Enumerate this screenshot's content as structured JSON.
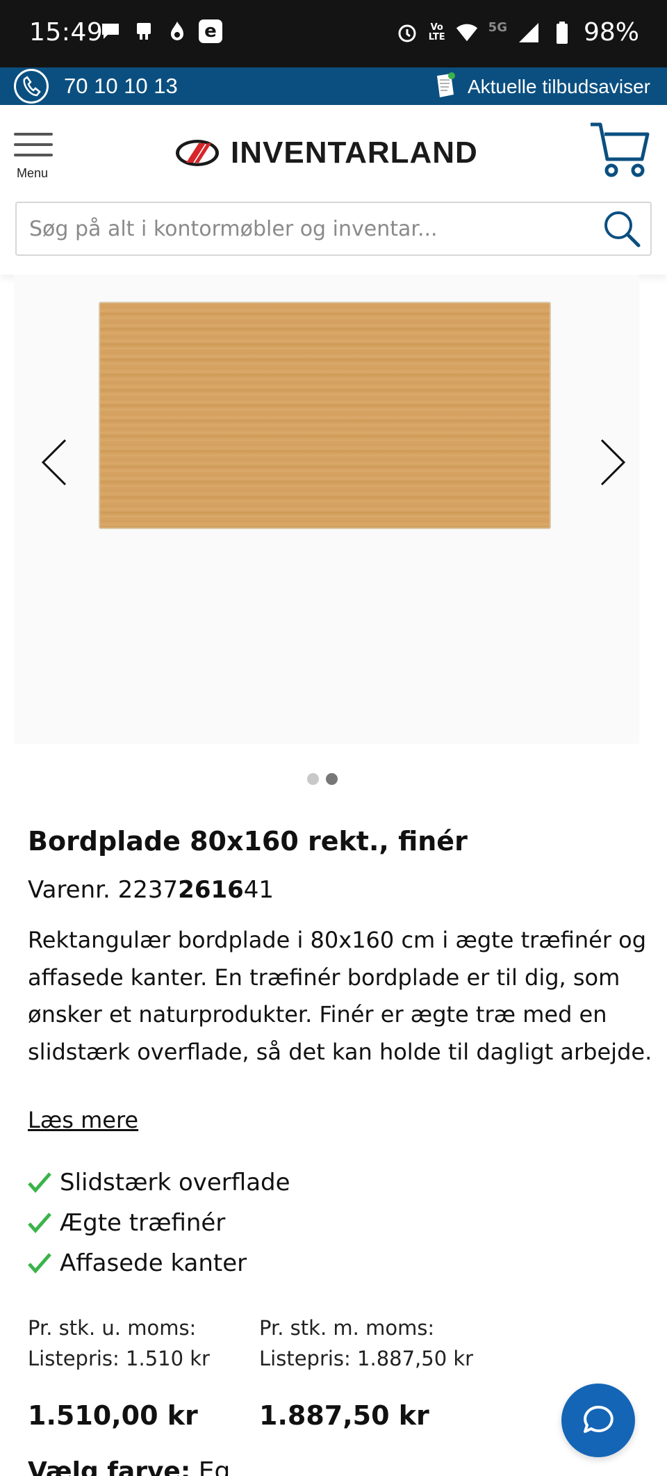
{
  "status_bar": {
    "time": "15:49",
    "battery": "98%",
    "network": "5G",
    "volte_top": "Vo",
    "volte_bottom": "LTE"
  },
  "topbar": {
    "phone": "70 10 10 13",
    "offers": "Aktuelle tilbudsaviser"
  },
  "header": {
    "menu_label": "Menu",
    "logo_text": "INVENTARLAND",
    "search_placeholder": "Søg på alt i kontormøbler og inventar..."
  },
  "gallery": {
    "slide_count": 2,
    "active_slide": 2
  },
  "product": {
    "title": "Bordplade 80x160 rekt., finér",
    "sku_prefix": "Varenr. 2237",
    "sku_bold": "2616",
    "sku_suffix": "41",
    "description": "Rektangulær bordplade i 80x160 cm i ægte træfinér og affasede kanter. En træfinér bordplade er til dig, som ønsker et naturprodukter. Finér er ægte træ med en slidstærk overflade, så det kan holde til dagligt arbejde.",
    "read_more": "Læs mere",
    "features": [
      "Slidstærk overflade",
      "Ægte træfinér",
      "Affasede kanter"
    ]
  },
  "prices": {
    "excl": {
      "label": "Pr. stk. u. moms:",
      "list": "Listepris: 1.510 kr",
      "price": "1.510,00 kr"
    },
    "incl": {
      "label": "Pr. stk. m. moms:",
      "list": "Listepris: 1.887,50 kr",
      "price": "1.887,50 kr"
    }
  },
  "color": {
    "label": "Vælg farve:",
    "value": "Eg"
  },
  "colors": {
    "brand_blue": "#0b4f80",
    "check_green": "#3bb34a",
    "chat_blue": "#1565b6",
    "logo_red": "#d6262b"
  }
}
